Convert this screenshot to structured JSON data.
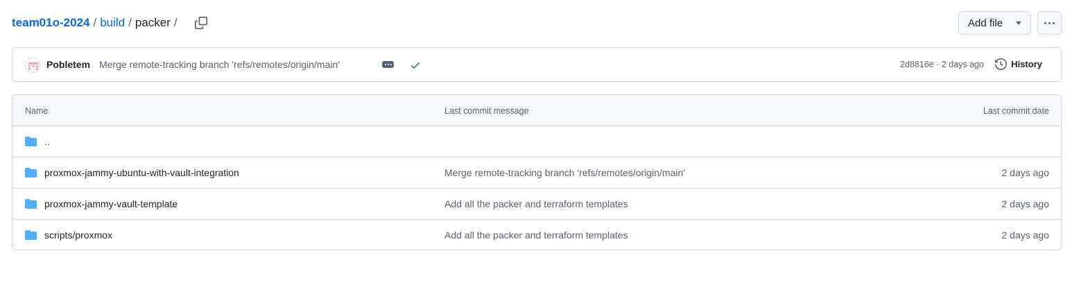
{
  "breadcrumb": {
    "repo": "team01o-2024",
    "dir1": "build",
    "current": "packer",
    "separator": "/"
  },
  "actions": {
    "add_file": "Add file"
  },
  "latest_commit": {
    "author": "Pobletem",
    "message": "Merge remote-tracking branch 'refs/remotes/origin/main'",
    "hash_and_time": "2d8816e · 2 days ago",
    "history_label": "History",
    "status": "success"
  },
  "table": {
    "headers": {
      "name": "Name",
      "message": "Last commit message",
      "date": "Last commit date"
    },
    "rows": [
      {
        "name": "..",
        "message": "",
        "date": ""
      },
      {
        "name": "proxmox-jammy-ubuntu-with-vault-integration",
        "message": "Merge remote-tracking branch 'refs/remotes/origin/main'",
        "date": "2 days ago"
      },
      {
        "name": "proxmox-jammy-vault-template",
        "message": "Add all the packer and terraform templates",
        "date": "2 days ago"
      },
      {
        "name": "scripts/proxmox",
        "message": "Add all the packer and terraform templates",
        "date": "2 days ago"
      }
    ]
  },
  "colors": {
    "link": "#0969da",
    "folder": "#54aeff",
    "success": "#1a7f37",
    "border": "#d1d9e0",
    "muted": "#59636e"
  },
  "icons": {
    "copy": "copy-icon",
    "more": "kebab-horizontal-icon",
    "check": "check-icon",
    "history": "history-icon",
    "folder": "folder-icon"
  }
}
